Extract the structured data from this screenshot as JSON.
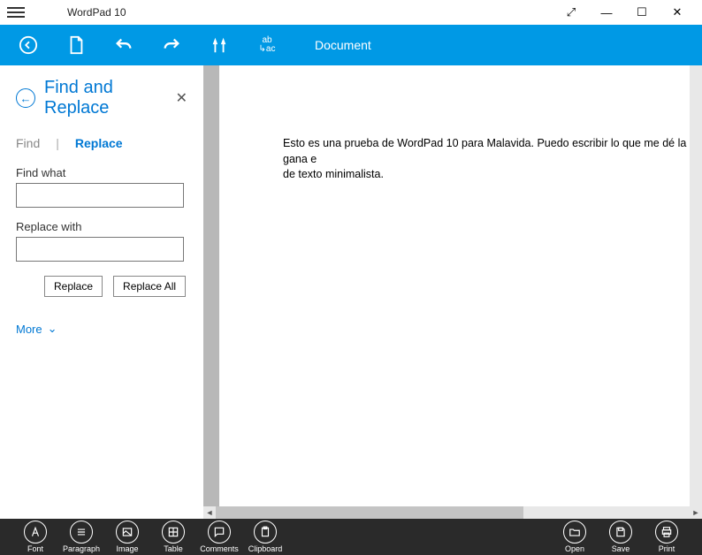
{
  "titlebar": {
    "title": "WordPad 10"
  },
  "toolbar": {
    "docname": "Document"
  },
  "sidebar": {
    "heading": "Find and Replace",
    "tabs": {
      "find": "Find",
      "replace": "Replace"
    },
    "find_label": "Find what",
    "find_value": "",
    "replace_label": "Replace with",
    "replace_value": "",
    "btn_replace": "Replace",
    "btn_replace_all": "Replace All",
    "more": "More"
  },
  "document": {
    "line1": "Esto es una prueba de WordPad 10 para Malavida. Puedo escribir lo que me dé la gana e",
    "line2": "de texto minimalista."
  },
  "bottom": {
    "font": "Font",
    "paragraph": "Paragraph",
    "image": "Image",
    "table": "Table",
    "comments": "Comments",
    "clipboard": "Clipboard",
    "open": "Open",
    "save": "Save",
    "print": "Print"
  }
}
